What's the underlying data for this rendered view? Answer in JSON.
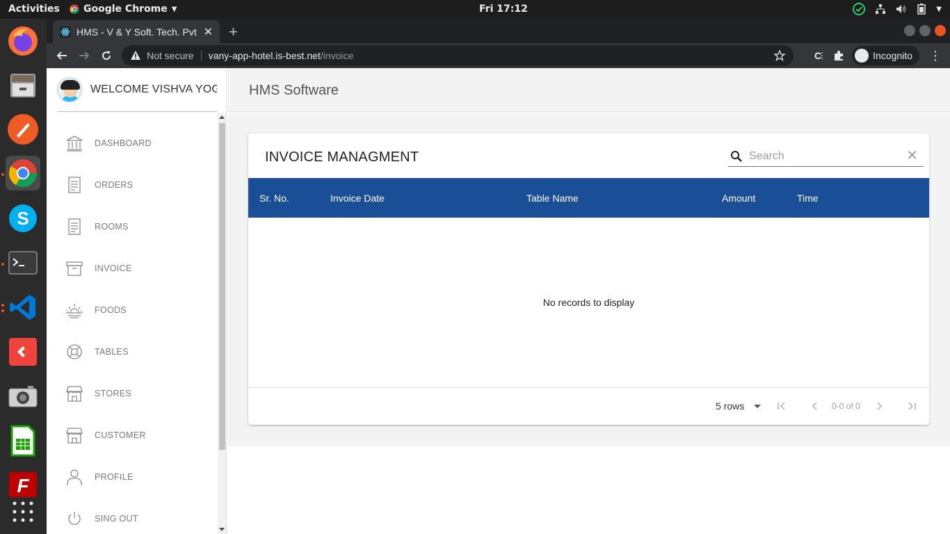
{
  "topbar": {
    "activities": "Activities",
    "app": "Google Chrome",
    "clock": "Fri 17:12"
  },
  "browser": {
    "tab_title": "HMS - V & Y Soft. Tech. Pvt",
    "not_secure": "Not secure",
    "url_host": "vany-app-hotel.is-best.net",
    "url_path": "/invoice",
    "incognito": "Incognito"
  },
  "sidebar": {
    "welcome": "WELCOME VISHVA YOGI",
    "items": [
      {
        "label": "DASHBOARD",
        "icon": "bank-icon"
      },
      {
        "label": "ORDERS",
        "icon": "receipt-icon"
      },
      {
        "label": "ROOMS",
        "icon": "receipt-icon"
      },
      {
        "label": "INVOICE",
        "icon": "archive-icon"
      },
      {
        "label": "FOODS",
        "icon": "sunrise-icon"
      },
      {
        "label": "TABLES",
        "icon": "lifebuoy-icon"
      },
      {
        "label": "STORES",
        "icon": "store-icon"
      },
      {
        "label": "CUSTOMER",
        "icon": "store-icon"
      },
      {
        "label": "PROFILE",
        "icon": "user-icon"
      },
      {
        "label": "SING OUT",
        "icon": "power-icon"
      }
    ]
  },
  "appbar": {
    "title": "HMS Software"
  },
  "invoice": {
    "title": "INVOICE MANAGMENT",
    "search_placeholder": "Search",
    "columns": [
      "Sr. No.",
      "Invoice Date",
      "Table Name",
      "Amount",
      "Time"
    ],
    "empty_message": "No records to display",
    "rows_per_page": "5 rows",
    "range": "0-0 of 0"
  },
  "colors": {
    "header_blue": "#1a4e96",
    "accent_orange": "#e95420"
  }
}
